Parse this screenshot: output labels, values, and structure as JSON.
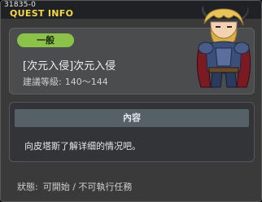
{
  "window": {
    "quest_id": "31835-0",
    "title": "QUEST INFO"
  },
  "quest": {
    "category": "一般",
    "name": "[次元入侵]次元入侵",
    "level_label": "建議等級:",
    "level_range": "140～144"
  },
  "content": {
    "header": "內容",
    "text": "向皮塔斯了解详细的情况吧。"
  },
  "status": {
    "label": "狀態:",
    "value": "可開始 / 不可執行任務"
  },
  "colors": {
    "title": "#f4d84a",
    "badge": "#8bc34a",
    "panel": "#4a4c4e",
    "content_header": "#556067"
  },
  "icons": {
    "npc_portrait": "horned-warrior-npc"
  }
}
